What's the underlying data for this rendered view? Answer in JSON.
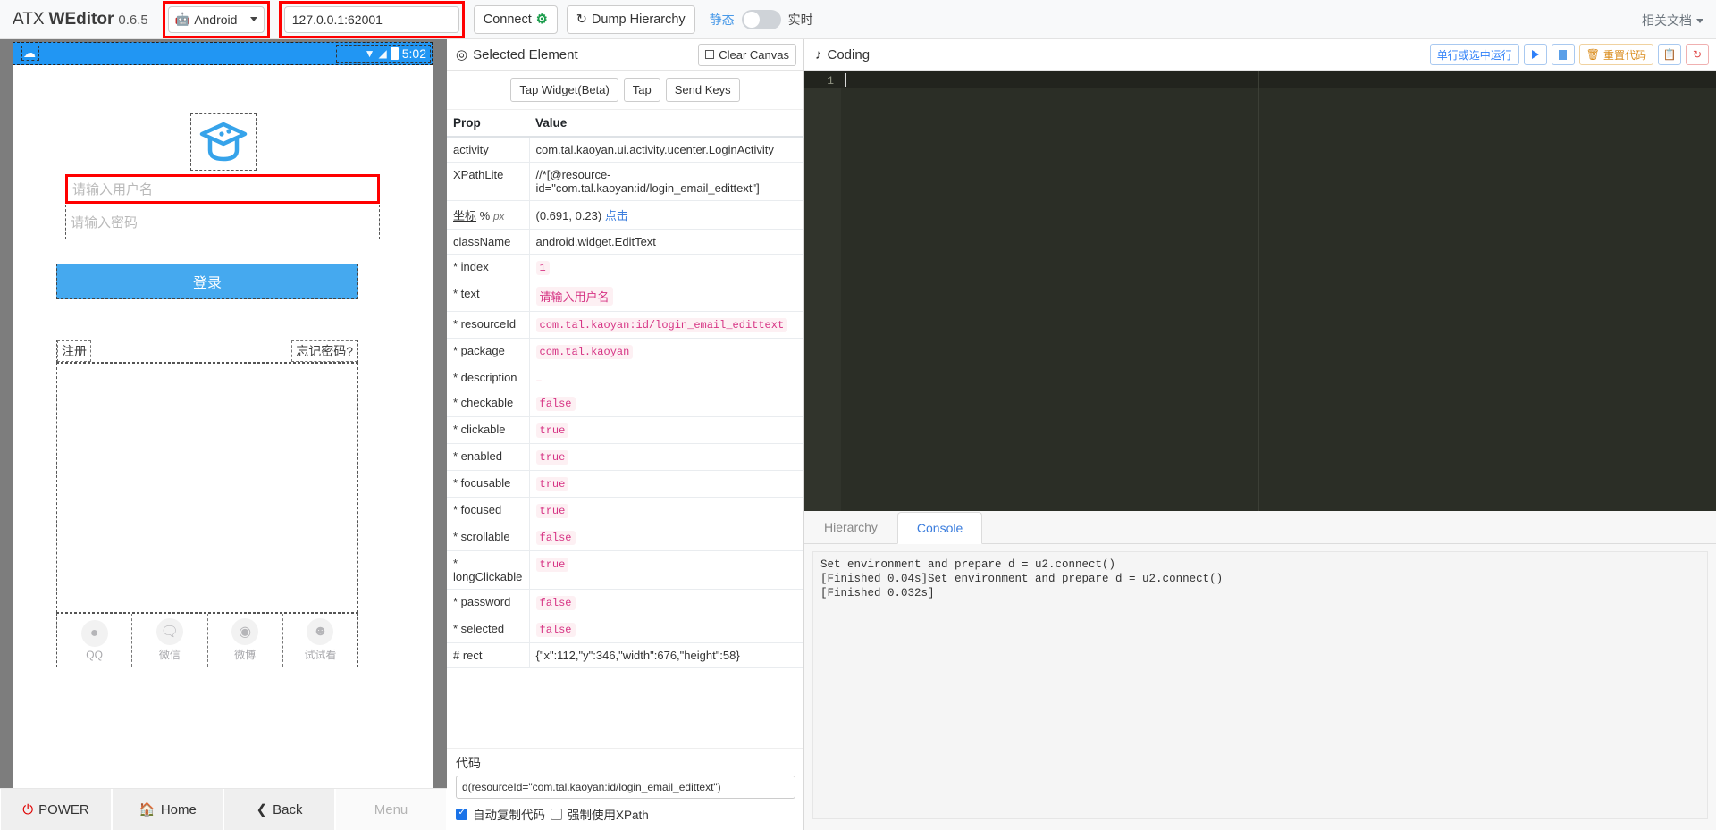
{
  "topbar": {
    "brand_prefix": "ATX",
    "brand_bold": "WEditor",
    "version": "0.6.5",
    "platform_value": "Android",
    "platform_icon": "android-icon",
    "address_value": "127.0.0.1:62001",
    "address_placeholder": "127.0.0.1:62001",
    "connect_label": "Connect",
    "dump_label": "Dump Hierarchy",
    "mode_static": "静态",
    "mode_live": "实时",
    "docs_label": "相关文档"
  },
  "phone": {
    "status_time": "5:02",
    "username_placeholder": "请输入用户名",
    "password_placeholder": "请输入密码",
    "login_label": "登录",
    "register_label": "注册",
    "forgot_label": "忘记密码?",
    "socials": [
      {
        "name": "QQ",
        "icon": "qq-icon",
        "glyph": "🐧"
      },
      {
        "name": "微信",
        "icon": "wechat-icon",
        "glyph": "💬"
      },
      {
        "name": "微博",
        "icon": "weibo-icon",
        "glyph": "◎"
      },
      {
        "name": "试试看",
        "icon": "ghost-icon",
        "glyph": "👻"
      }
    ],
    "nav": [
      {
        "label": "POWER",
        "icon": "power-icon",
        "disabled": false
      },
      {
        "label": "Home",
        "icon": "home-icon",
        "disabled": false
      },
      {
        "label": "Back",
        "icon": "back-icon",
        "disabled": false
      },
      {
        "label": "Menu",
        "icon": "menu-icon",
        "disabled": true
      }
    ]
  },
  "inspector": {
    "title": "Selected Element",
    "title_icon": "target-icon",
    "clear_canvas_label": "Clear Canvas",
    "actions": [
      "Tap Widget(Beta)",
      "Tap",
      "Send Keys"
    ],
    "columns": [
      "Prop",
      "Value"
    ],
    "rows": [
      {
        "key": "activity",
        "value": "com.tal.kaoyan.ui.activity.ucenter.LoginActivity",
        "style": "plain"
      },
      {
        "key": "XPathLite",
        "value": "//*[@resource-id=\"com.tal.kaoyan:id/login_email_edittext\"]",
        "style": "plain"
      },
      {
        "key": "坐标 % px",
        "value": "(0.691, 0.23)",
        "link": "点击",
        "style": "coord"
      },
      {
        "key": "className",
        "value": "android.widget.EditText",
        "style": "plain"
      },
      {
        "key": "* index",
        "value": "1",
        "style": "pill"
      },
      {
        "key": "* text",
        "value": "请输入用户名",
        "style": "pill-cjk"
      },
      {
        "key": "* resourceId",
        "value": "com.tal.kaoyan:id/login_email_edittext",
        "style": "pill"
      },
      {
        "key": "* package",
        "value": "com.tal.kaoyan",
        "style": "pill"
      },
      {
        "key": "* description",
        "value": "",
        "style": "pill-empty"
      },
      {
        "key": "* checkable",
        "value": "false",
        "style": "pill"
      },
      {
        "key": "* clickable",
        "value": "true",
        "style": "pill"
      },
      {
        "key": "* enabled",
        "value": "true",
        "style": "pill"
      },
      {
        "key": "* focusable",
        "value": "true",
        "style": "pill"
      },
      {
        "key": "* focused",
        "value": "true",
        "style": "pill"
      },
      {
        "key": "* scrollable",
        "value": "false",
        "style": "pill"
      },
      {
        "key": "* longClickable",
        "value": "true",
        "style": "pill"
      },
      {
        "key": "* password",
        "value": "false",
        "style": "pill"
      },
      {
        "key": "* selected",
        "value": "false",
        "style": "pill"
      },
      {
        "key": "# rect",
        "value": "{\"x\":112,\"y\":346,\"width\":676,\"height\":58}",
        "style": "plain"
      }
    ],
    "code_caption": "代码",
    "code_value": "d(resourceId=\"com.tal.kaoyan:id/login_email_edittext\")",
    "auto_copy_label": "自动复制代码",
    "auto_copy_checked": true,
    "force_xpath_label": "强制使用XPath",
    "force_xpath_checked": false
  },
  "coding": {
    "title": "Coding",
    "title_icon": "note-icon",
    "run_selection_label": "单行或选中运行",
    "run_icon": "play-icon",
    "stop_icon": "stop-icon",
    "reset_label": "重置代码",
    "reset_icon": "trash-icon",
    "copy_icon": "copy-icon",
    "refresh_icon": "refresh-icon",
    "line_number": "1",
    "editor_content": "",
    "editor_bg": "#2b2e26"
  },
  "bottom": {
    "tabs": [
      {
        "label": "Hierarchy",
        "active": false
      },
      {
        "label": "Console",
        "active": true
      }
    ],
    "console_lines": [
      "Set environment and prepare d = u2.connect()",
      "[Finished 0.04s]Set environment and prepare d = u2.connect()",
      "[Finished 0.032s]"
    ]
  },
  "colors": {
    "accent_blue": "#2196f3",
    "link_blue": "#3b7ddd",
    "highlight_red": "#ff0000",
    "pill_pink": "#d63384"
  }
}
